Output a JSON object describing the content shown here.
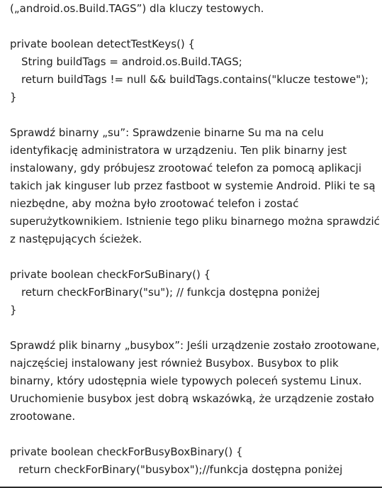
{
  "intro": {
    "line1": "(„android.os.Build.TAGS”) dla kluczy testowych."
  },
  "code1": {
    "sig": "private boolean detectTestKeys() {",
    "body1": "String buildTags = android.os.Build.TAGS;",
    "body2": "return buildTags != null && buildTags.contains(\"klucze testowe\");",
    "close": "}"
  },
  "para_su": {
    "l1": "Sprawdź binarny „su”: Sprawdzenie binarne Su ma na celu",
    "l2": "identyfikację administratora w urządzeniu. Ten plik binarny jest",
    "l3": "instalowany, gdy próbujesz zrootować telefon za pomocą aplikacji",
    "l4": "takich jak kinguser lub przez fastboot w systemie Android. Pliki te są",
    "l5": "niezbędne, aby można było zrootować telefon i zostać",
    "l6": "superużytkownikiem. Istnienie tego pliku binarnego można sprawdzić",
    "l7": "z następujących ścieżek."
  },
  "code2": {
    "sig": "private boolean checkForSuBinary() {",
    "body": "return checkForBinary(\"su\"); // funkcja dostępna poniżej",
    "close": "}"
  },
  "para_busybox": {
    "l1": "Sprawdź plik binarny „busybox”: Jeśli urządzenie zostało zrootowane,",
    "l2": "najczęściej instalowany jest również Busybox. Busybox to plik",
    "l3": "binarny, który udostępnia wiele typowych poleceń systemu Linux.",
    "l4": "Uruchomienie busybox jest dobrą wskazówką, że urządzenie zostało",
    "l5": "zrootowane."
  },
  "code3": {
    "sig": "private boolean checkForBusyBoxBinary() {",
    "body": "return checkForBinary(\"busybox\");//funkcja dostępna poniżej"
  }
}
